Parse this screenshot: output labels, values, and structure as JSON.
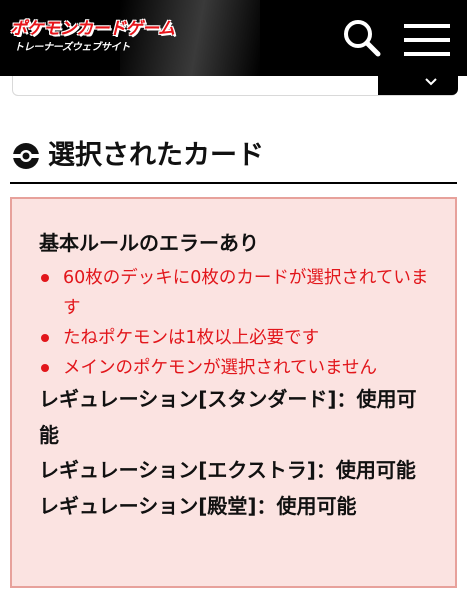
{
  "header": {
    "logo_main": "ポケモンカードゲーム",
    "logo_sub": "トレーナーズウェブサイト",
    "search_icon": "search-icon",
    "menu_icon": "hamburger-menu-icon",
    "background": "#000000"
  },
  "search": {
    "submit_icon": "chevron-down-icon"
  },
  "section": {
    "title": "選択されたカード",
    "icon": "pokeball-icon"
  },
  "error_box": {
    "heading": "基本ルールのエラーあり",
    "errors": [
      "60枚のデッキに0枚のカードが選択されています",
      "たねポケモンは1枚以上必要です",
      "メインのポケモンが選択されていません"
    ],
    "regulations": [
      "レギュレーション[スタンダード]：使用可能",
      "レギュレーション[エクストラ]：使用可能",
      "レギュレーション[殿堂]：使用可能"
    ],
    "error_color": "#e2161b",
    "background": "#fbe3e1",
    "border": "#e7a19b"
  }
}
